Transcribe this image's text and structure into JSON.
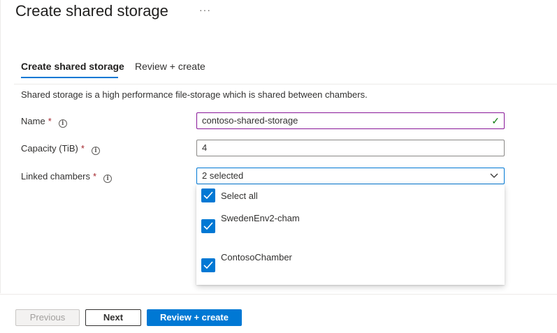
{
  "header": {
    "title": "Create shared storage",
    "more_glyph": "···"
  },
  "tabs": [
    {
      "label": "Create shared storage",
      "active": true
    },
    {
      "label": "Review + create",
      "active": false
    }
  ],
  "description": "Shared storage is a high performance file-storage which is shared between chambers.",
  "form": {
    "required_mark": "*",
    "info_glyph": "i",
    "name": {
      "label": "Name",
      "value": "contoso-shared-storage",
      "valid": true
    },
    "capacity": {
      "label": "Capacity (TiB)",
      "value": "4"
    },
    "linked_chambers": {
      "label": "Linked chambers",
      "selected_text": "2 selected",
      "options": [
        {
          "label": "Select all",
          "checked": true
        },
        {
          "label": "SwedenEnv2-cham",
          "checked": true
        },
        {
          "label": "ContosoChamber",
          "checked": true
        }
      ]
    }
  },
  "footer": {
    "previous_label": "Previous",
    "next_label": "Next",
    "review_label": "Review + create"
  },
  "colors": {
    "accent": "#0078d4",
    "required": "#a4262c",
    "valid_border": "#881798",
    "valid_check": "#107c10"
  },
  "icons": [
    "more-icon",
    "info-icon",
    "checkmark-icon",
    "chevron-down-icon",
    "checkbox-checked-icon"
  ]
}
